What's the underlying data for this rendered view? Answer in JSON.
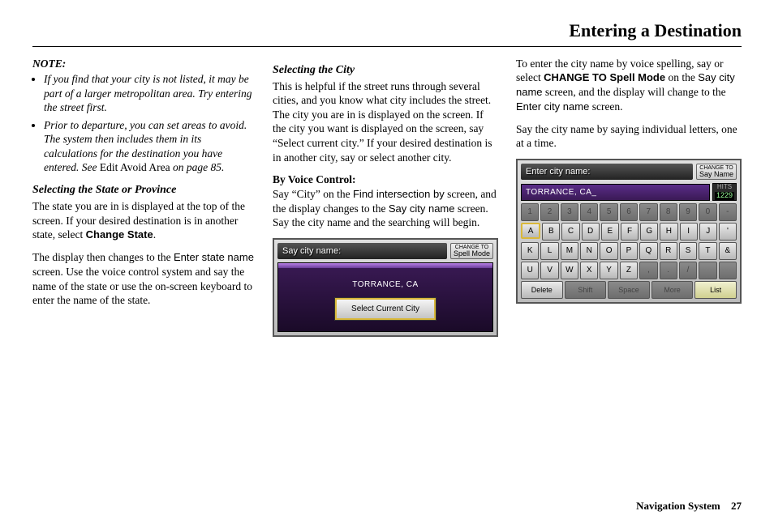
{
  "header": "Entering a Destination",
  "col1": {
    "note_label": "NOTE:",
    "bullet1": "If you find that your city is not listed, it may be part of a larger metropolitan area. Try entering the street first.",
    "bullet2a": "Prior to departure, you can set areas to avoid. The system then includes them in its calculations for the destination you have entered. See ",
    "bullet2b": "Edit Avoid Area",
    "bullet2c": " on page 85.",
    "sec1_title": "Selecting the State or Province",
    "sec1_p1a": "The state you are in is displayed at the top of the screen. If your desired destination is in another state, select ",
    "sec1_p1b": "Change State",
    "sec1_p1c": ".",
    "sec1_p2a": "The display then changes to the ",
    "sec1_p2b": "Enter state name",
    "sec1_p2c": " screen. Use the voice control system and say the name of the state or use the on-screen keyboard to enter the name of the state."
  },
  "col2": {
    "sec_title": "Selecting the City",
    "p1": "This is helpful if the street runs through several cities, and you know what city includes the street. The city you are in is displayed on the screen. If the city you want is displayed on the screen, say “Select current city.” If your desired destination is in another city, say or select another city.",
    "sub": "By Voice Control:",
    "p2a": "Say “City” on the ",
    "p2b": "Find intersection by",
    "p2c": " screen, and the display changes to the ",
    "p2d": "Say city name",
    "p2e": " screen. Say the city name and the searching will begin.",
    "screen": {
      "title": "Say city name:",
      "change_top": "CHANGE",
      "change_to": "TO",
      "change_mode": "Spell Mode",
      "current": "TORRANCE, CA",
      "button": "Select Current City"
    }
  },
  "col3": {
    "p1a": "To enter the city name by voice spelling, say or select ",
    "p1b": "CHANGE TO Spell Mode",
    "p1c": " on the ",
    "p1d": "Say city name",
    "p1e": " screen, and the display will change to the ",
    "p1f": "Enter city name",
    "p1g": " screen.",
    "p2": "Say the city name by saying individual letters, one at a time.",
    "screen": {
      "title": "Enter city name:",
      "change_top": "CHANGE",
      "change_to": "TO",
      "change_mode": "Say Name",
      "input": "TORRANCE, CA_",
      "hits_label": "HITS",
      "hits_value": "1229",
      "row_num": [
        "1",
        "2",
        "3",
        "4",
        "5",
        "6",
        "7",
        "8",
        "9",
        "0",
        "-"
      ],
      "row_a": [
        "A",
        "B",
        "C",
        "D",
        "E",
        "F",
        "G",
        "H",
        "I",
        "J",
        "'"
      ],
      "row_k": [
        "K",
        "L",
        "M",
        "N",
        "O",
        "P",
        "Q",
        "R",
        "S",
        "T",
        "&"
      ],
      "row_u": [
        "U",
        "V",
        "W",
        "X",
        "Y",
        "Z",
        ",",
        ".",
        "/",
        " ",
        " "
      ],
      "bottom": [
        "Delete",
        "Shift",
        "Space",
        "More",
        "List"
      ]
    }
  },
  "footer": {
    "label": "Navigation System",
    "page": "27"
  }
}
